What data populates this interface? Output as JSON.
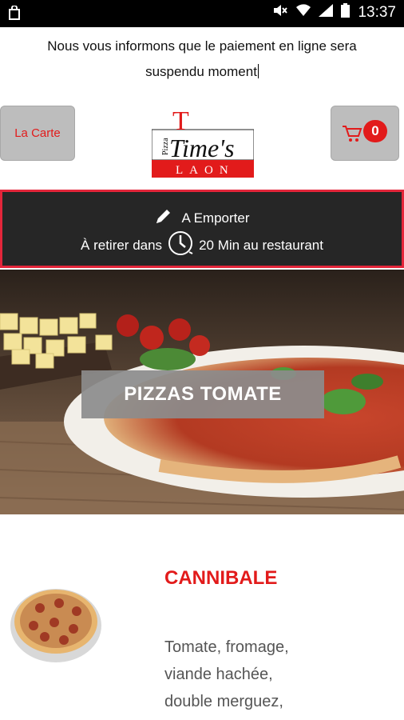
{
  "statusbar": {
    "time": "13:37",
    "icons": [
      "shopping-bag-icon",
      "mute-icon",
      "wifi-icon",
      "signal-icon",
      "battery-icon"
    ]
  },
  "notice": {
    "line1": "Nous vous informons que le paiement en ligne sera",
    "line2": "suspendu moment"
  },
  "header": {
    "menu_button": "La Carte",
    "cart_count": "0",
    "logo": {
      "small": "Pizza",
      "main": "Time's",
      "sub": "LAON"
    }
  },
  "order": {
    "mode": "A Emporter",
    "pickup_prefix": "À retirer dans",
    "pickup_suffix": "20 Min au restaurant"
  },
  "category": {
    "label": "PIZZAS TOMATE"
  },
  "product": {
    "name": "CANNIBALE",
    "description": "Tomate, fromage, viande hachée, double merguez,"
  },
  "colors": {
    "accent": "#e21b1b",
    "order_border": "#e3263a",
    "order_bg": "#262626",
    "button_bg": "#bdbdbd"
  }
}
